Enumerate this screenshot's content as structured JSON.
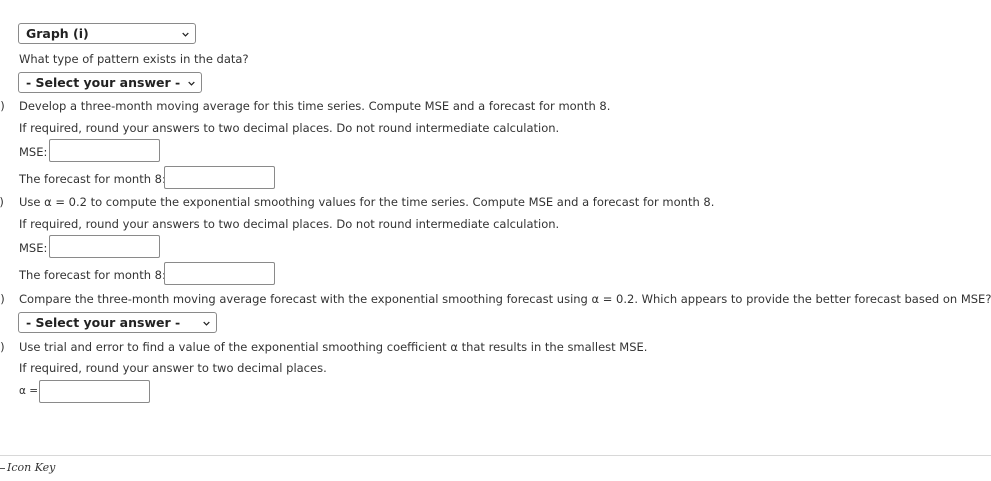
{
  "graph_select": {
    "value": "Graph (i)"
  },
  "pattern_question": "What type of pattern exists in the data?",
  "pattern_select": {
    "value": "- Select your answer -"
  },
  "part_b": {
    "letter": "b)",
    "prompt": "Develop a three-month moving average for this time series. Compute MSE and a forecast for month 8.",
    "rounding": "If required, round your answers to two decimal places. Do not round intermediate calculation.",
    "mse_label": "MSE:",
    "mse_value": "",
    "forecast_label": "The forecast for month 8:",
    "forecast_value": ""
  },
  "part_c": {
    "letter": "c)",
    "prompt": "Use α = 0.2 to compute the exponential smoothing values for the time series. Compute MSE and a forecast for month 8.",
    "rounding": "If required, round your answers to two decimal places. Do not round intermediate calculation.",
    "mse_label": "MSE:",
    "mse_value": "",
    "forecast_label": "The forecast for month 8:",
    "forecast_value": ""
  },
  "part_d": {
    "letter": "d)",
    "prompt": "Compare the three-month moving average forecast with the exponential smoothing forecast using α = 0.2. Which appears to provide the better forecast based on MSE?",
    "select_value": "- Select your answer -"
  },
  "part_e": {
    "letter": "e)",
    "prompt": "Use trial and error to find a value of the exponential smoothing coefficient α that results in the smallest MSE.",
    "rounding": "If required, round your answer to two decimal places.",
    "alpha_label": "α =",
    "alpha_value": ""
  },
  "footer": {
    "icon_key": "Icon Key"
  }
}
